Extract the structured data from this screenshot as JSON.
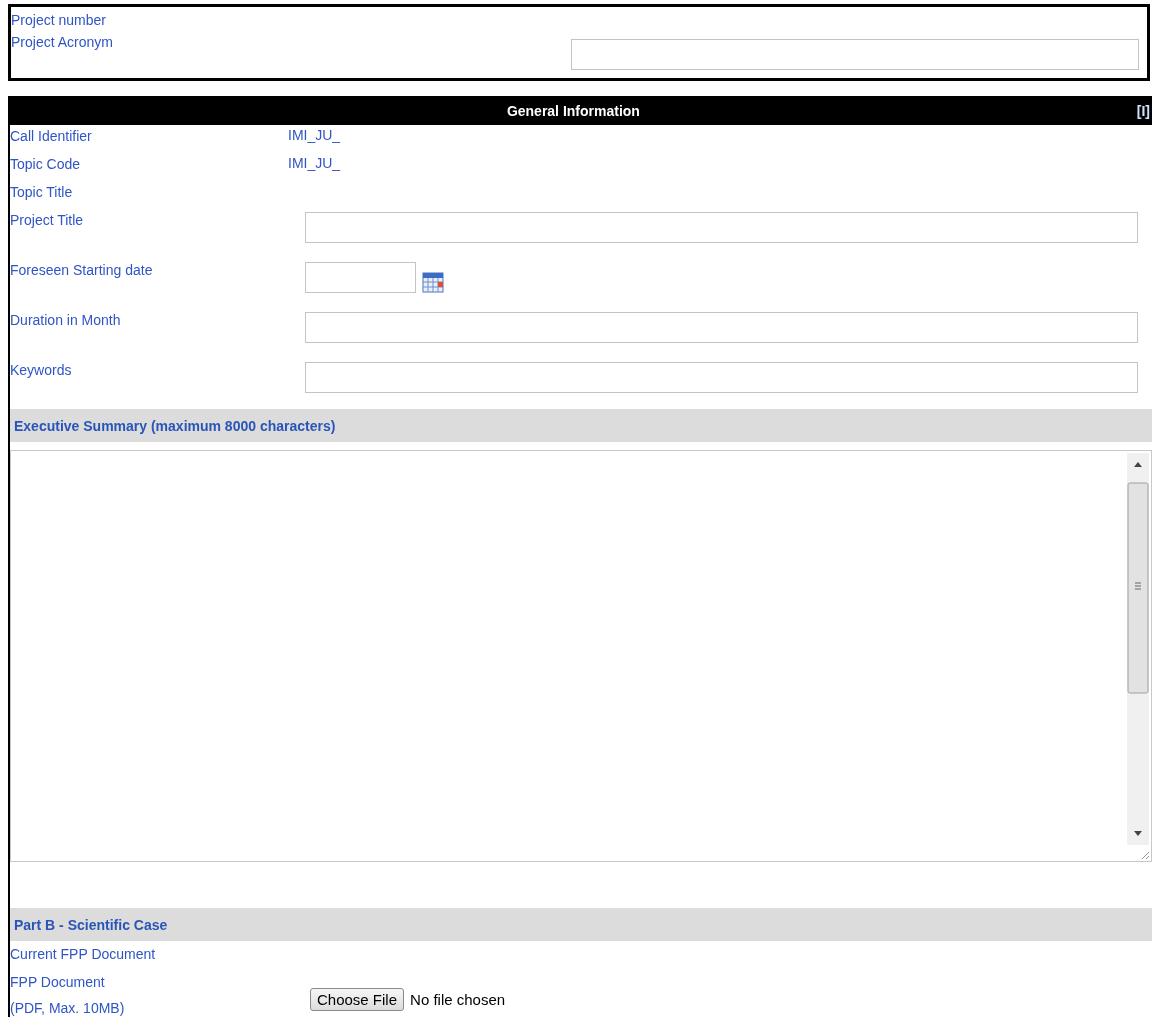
{
  "project": {
    "rows": [
      {
        "label": "Project number",
        "kind": "text"
      },
      {
        "label": "Project Acronym",
        "kind": "input"
      }
    ]
  },
  "general": {
    "title": "General Information",
    "toggle": "[I]",
    "rows": [
      {
        "label": "Call Identifier",
        "kind": "text",
        "value": "IMI_JU_"
      },
      {
        "label": "Topic Code",
        "kind": "text",
        "value": "IMI_JU_"
      },
      {
        "label": "Topic Title",
        "kind": "text"
      },
      {
        "label": "Project Title",
        "kind": "input"
      },
      {
        "label": "Foreseen Starting date",
        "kind": "date"
      },
      {
        "label": "Duration in Month",
        "kind": "input"
      },
      {
        "label": "Keywords",
        "kind": "input"
      }
    ]
  },
  "summary": {
    "title": "Executive Summary (maximum 8000 characters)"
  },
  "part_b": {
    "title": "Part B - Scientific Case",
    "rows": [
      {
        "label": "Current FPP Document",
        "kind": "text"
      },
      {
        "label": "FPP Document",
        "note": "(PDF, Max. 10MB)",
        "kind": "file",
        "button": "Choose File",
        "status": "No file chosen"
      }
    ]
  }
}
